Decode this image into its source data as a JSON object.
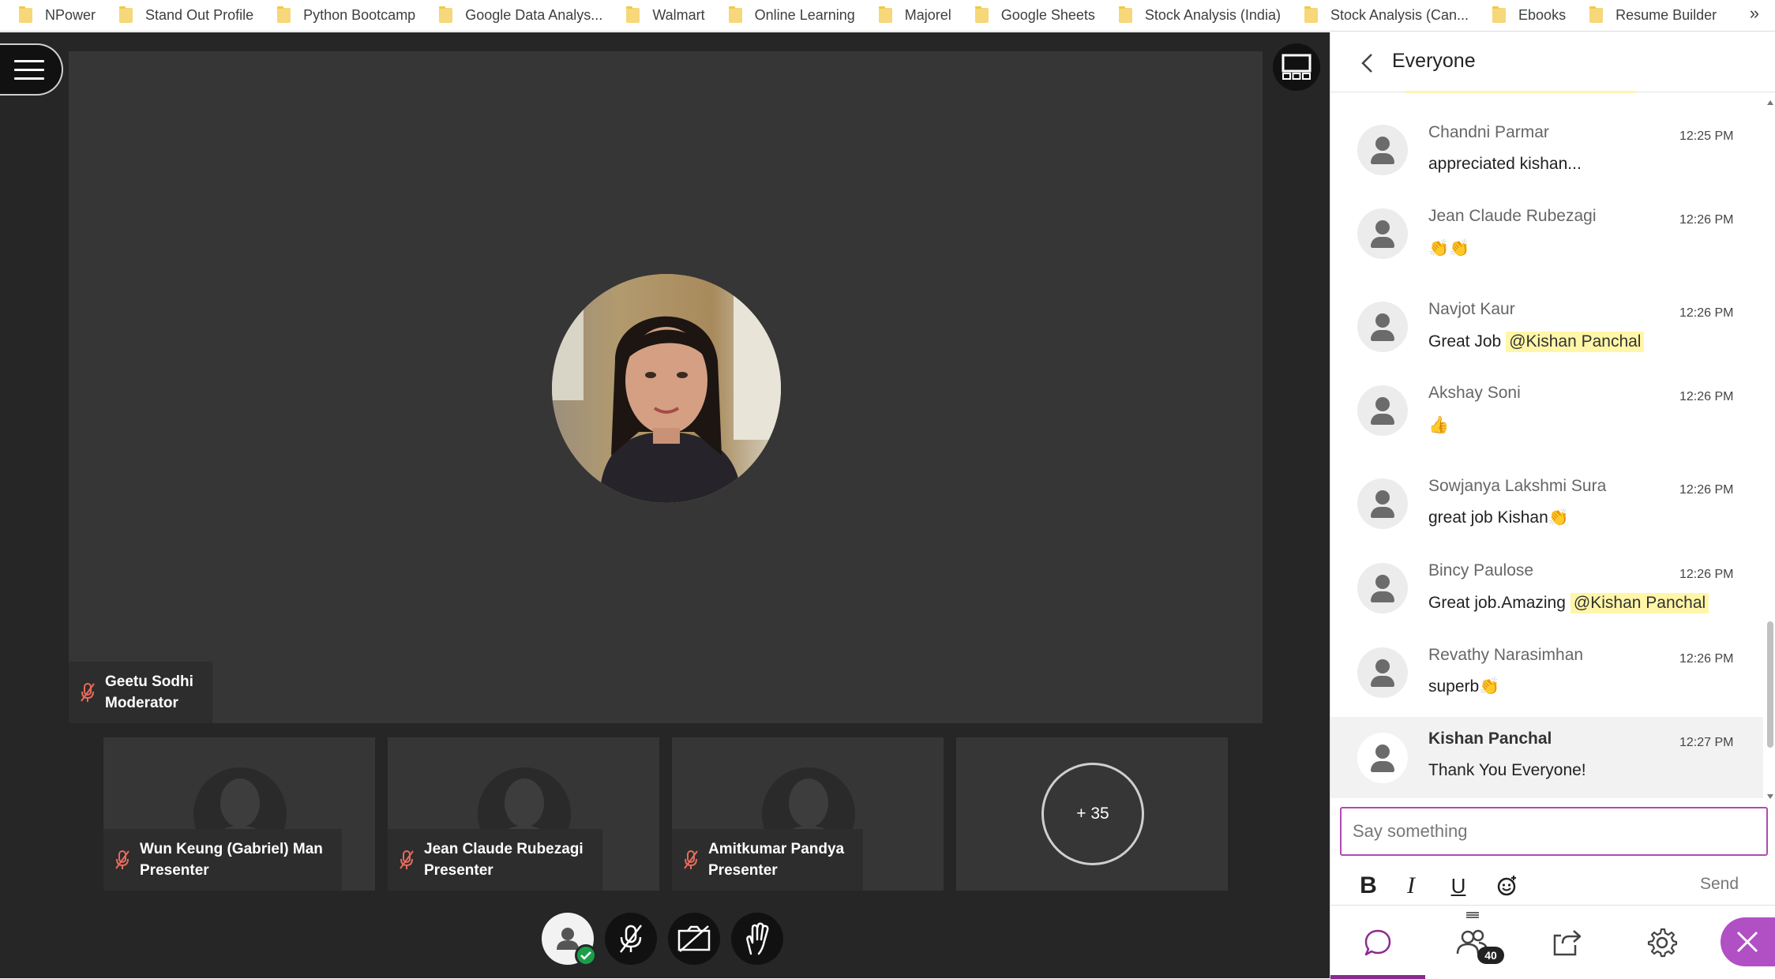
{
  "bookmarks": {
    "items": [
      {
        "label": "NPower"
      },
      {
        "label": "Stand Out Profile"
      },
      {
        "label": "Python Bootcamp"
      },
      {
        "label": "Google Data Analys..."
      },
      {
        "label": "Walmart"
      },
      {
        "label": "Online Learning"
      },
      {
        "label": "Majorel"
      },
      {
        "label": "Google Sheets"
      },
      {
        "label": "Stock Analysis (India)"
      },
      {
        "label": "Stock Analysis (Can..."
      },
      {
        "label": "Ebooks"
      },
      {
        "label": "Resume Builder"
      }
    ],
    "more": "»"
  },
  "stage": {
    "speaker": {
      "name": "Geetu Sodhi",
      "role": "Moderator"
    },
    "tiles": [
      {
        "name": "Wun Keung (Gabriel) Man",
        "role": "Presenter"
      },
      {
        "name": "Jean Claude Rubezagi",
        "role": "Presenter"
      },
      {
        "name": "Amitkumar Pandya",
        "role": "Presenter"
      }
    ],
    "more_count": "+ 35"
  },
  "chat": {
    "title": "Everyone",
    "messages": [
      {
        "author": "Chandni Parmar",
        "time": "12:25 PM",
        "text": "appreciated kishan..."
      },
      {
        "author": "Jean Claude Rubezagi",
        "time": "12:26 PM",
        "text": "👏👏"
      },
      {
        "author": "Navjot Kaur",
        "time": "12:26 PM",
        "text": "Great Job",
        "mention": "@Kishan Panchal"
      },
      {
        "author": "Akshay Soni",
        "time": "12:26 PM",
        "text": "👍"
      },
      {
        "author": "Sowjanya Lakshmi Sura",
        "time": "12:26 PM",
        "text": "great job Kishan👏"
      },
      {
        "author": "Bincy Paulose",
        "time": "12:26 PM",
        "text": "Great job.Amazing",
        "mention": "@Kishan Panchal"
      },
      {
        "author": "Revathy Narasimhan",
        "time": "12:26 PM",
        "text": "superb👏"
      },
      {
        "author": "Kishan Panchal",
        "time": "12:27 PM",
        "text": "Thank You Everyone!"
      }
    ],
    "compose_placeholder": "Say something",
    "format": {
      "bold": "B",
      "italic": "I",
      "underline": "U"
    },
    "send_label": "Send",
    "attendee_count": "40"
  },
  "colors": {
    "accent": "#8a2b8f",
    "close": "#b14fc5",
    "mention_bg": "#fff6a8",
    "stage_bg": "#262626"
  }
}
